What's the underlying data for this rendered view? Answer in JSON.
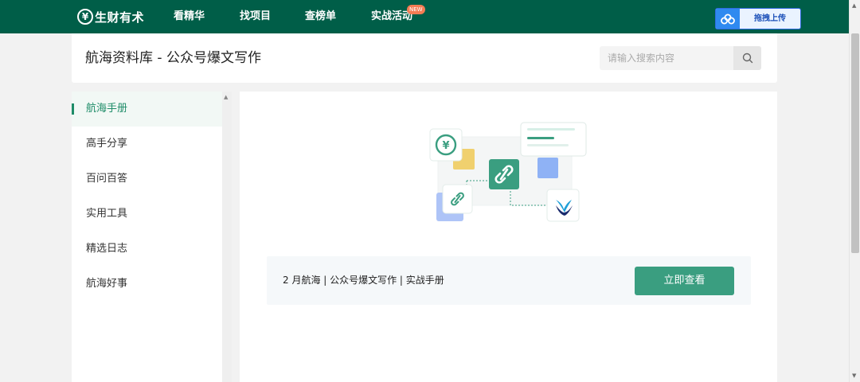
{
  "nav": {
    "logo_text": "生财有术",
    "items": [
      {
        "label": "看精华"
      },
      {
        "label": "找项目"
      },
      {
        "label": "查榜单"
      },
      {
        "label": "实战活动",
        "badge": "NEW"
      }
    ],
    "upload_label": "拖拽上传"
  },
  "header": {
    "title": "航海资料库 - 公众号爆文写作",
    "search_placeholder": "请输入搜索内容"
  },
  "sidebar": {
    "items": [
      {
        "label": "航海手册",
        "active": true
      },
      {
        "label": "高手分享",
        "active": false
      },
      {
        "label": "百问百答",
        "active": false
      },
      {
        "label": "实用工具",
        "active": false
      },
      {
        "label": "精选日志",
        "active": false
      },
      {
        "label": "航海好事",
        "active": false
      }
    ]
  },
  "content": {
    "banner_text": "2 月航海 | 公众号爆文写作 | 实战手册",
    "button_label": "立即查看"
  },
  "colors": {
    "brand": "#005e48",
    "accent": "#1e8c68",
    "button": "#3a9e80",
    "upload": "#2f8af0",
    "badge": "#f47c54"
  },
  "icons": {
    "logo": "yuan-coin-icon",
    "upload": "cloud-icon",
    "search": "search-icon",
    "illustration": [
      "coin-icon",
      "link-icon",
      "check-logo-icon",
      "document-icon"
    ]
  }
}
